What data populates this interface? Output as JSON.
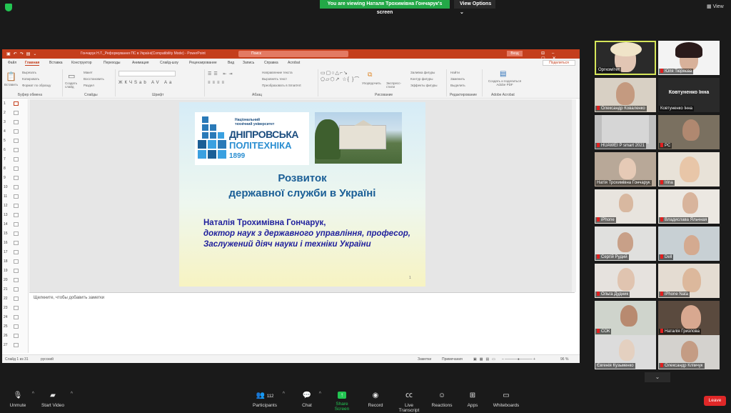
{
  "zoom_top": {
    "viewing_banner": "You are viewing Наталя Трохимівна Гончарук's screen",
    "view_options_label": "View Options",
    "view_label": "View"
  },
  "ppt": {
    "doc_title": "Гончарук Н.Т._Реформування ПС в Україні(Compatibility Mode)  -  PowerPoint",
    "search_placeholder": "Поиск",
    "sign_in": "Вход",
    "share_label": "Поделиться",
    "tabs": [
      "Файл",
      "Главная",
      "Вставка",
      "Конструктор",
      "Переходы",
      "Анимация",
      "Слайд-шоу",
      "Рецензирование",
      "Вид",
      "Запись",
      "Справка",
      "Acrobat"
    ],
    "ribbon": {
      "groups": [
        "Буфер обмена",
        "Слайды",
        "Шрифт",
        "Абзац",
        "Рисование",
        "Редактирование",
        "Adobe Acrobat"
      ],
      "paste": "Вставить",
      "cut": "Вырезать",
      "copy": "Копировать",
      "format_painter": "Формат по образцу",
      "new_slide": "Создать слайд",
      "layout": "Макет",
      "reset": "Восстановить",
      "section": "Раздел",
      "text_direction": "Направление текста",
      "align_text": "Выровнять текст",
      "smartart": "Преобразовать в SmartArt",
      "arrange": "Упорядочить",
      "quick_styles": "Экспресс-стили",
      "shape_fill": "Заливка фигуры",
      "shape_outline": "Контур фигуры",
      "shape_effects": "Эффекты фигуры",
      "find": "Найти",
      "replace": "Заменить",
      "select": "Выделить",
      "acrobat": "Создать и поделиться Adobe PDF"
    },
    "thumb_numbers": [
      "1",
      "2",
      "3",
      "4",
      "5",
      "6",
      "7",
      "8",
      "9",
      "10",
      "11",
      "12",
      "13",
      "14",
      "15",
      "16",
      "17",
      "18",
      "19",
      "20",
      "21",
      "22",
      "23",
      "24",
      "25",
      "26",
      "27"
    ],
    "notes_placeholder": "Щелкните, чтобы добавить заметки",
    "status": {
      "slide": "Слайд 1 из 31",
      "language": "русский",
      "notes": "Заметки",
      "comments": "Примечания",
      "zoom": "96 %"
    }
  },
  "slide": {
    "logo_small": "Національний технічний університет",
    "logo_line1": "ДНІПРОВСЬКА",
    "logo_line2": "ПОЛІТЕХНІКА",
    "logo_year": "1899",
    "title_line1": "Розвиток",
    "title_line2": "державної служби в Україні",
    "author": "Наталія Трохимівна Гончарук,",
    "degree": "доктор наук з державного управління, професор,",
    "honor": "Заслужений діяч науки і техніки України",
    "page_number": "1"
  },
  "gallery": [
    {
      "name": "Оргкомітет"
    },
    {
      "name": "Юля Тюряєва"
    },
    {
      "name": "Олександр Коваленко"
    },
    {
      "name": "Ковтуненко Інна",
      "big": "Ковтуненко Інна"
    },
    {
      "name": "HUAWEI P smart 2021"
    },
    {
      "name": "PC"
    },
    {
      "name": "Натія Трохимівна Гончарук"
    },
    {
      "name": "Irina"
    },
    {
      "name": "iPhone"
    },
    {
      "name": "Владислава Яльчная"
    },
    {
      "name": "Сергій Рудий"
    },
    {
      "name": "Dell"
    },
    {
      "name": "Ольга Дудник"
    },
    {
      "name": "iPhone Nata"
    },
    {
      "name": "СОК"
    },
    {
      "name": "Наталія Гризлова"
    },
    {
      "name": "Євгенія Кузьменко"
    },
    {
      "name": "Олександр Клімчук"
    }
  ],
  "toolbar": {
    "unmute": "Unmute",
    "start_video": "Start Video",
    "participants": "Participants",
    "participants_count": "112",
    "chat": "Chat",
    "share_screen": "Share Screen",
    "record": "Record",
    "live_transcript": "Live Transcript",
    "reactions": "Reactions",
    "apps": "Apps",
    "whiteboards": "Whiteboards",
    "leave": "Leave"
  },
  "colors": {
    "zoom_green": "#23a847",
    "ppt_red": "#c43e1c",
    "leave_red": "#e02828",
    "slide_title": "#1a5e96",
    "slide_body": "#1f1f9c"
  }
}
